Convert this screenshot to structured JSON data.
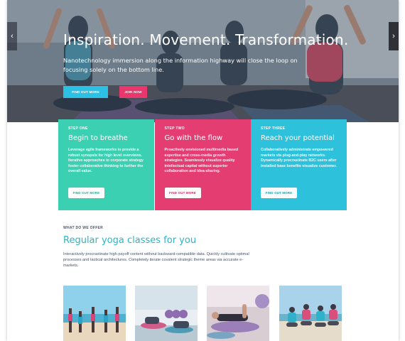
{
  "hero": {
    "title": "Inspiration. Movement. Transformation.",
    "subtitle": "Nanotechnology immersion along the information highway will close the loop on focusing solely on the bottom line.",
    "find_out_more": "FIND OUT MORE",
    "join_now": "JOIN NOW",
    "prev_icon": "chevron-left-icon",
    "next_icon": "chevron-right-icon"
  },
  "steps": [
    {
      "label": "STEP ONE",
      "title": "Begin to breathe",
      "text": "Leverage agile frameworks to provide a robust synopsis for high level overviews. Iterative approaches to corporate strategy foster collaborative thinking to further the overall value.",
      "button": "FIND OUT MORE",
      "color": "#3cd0b2"
    },
    {
      "label": "STEP TWO",
      "title": "Go with the flow",
      "text": "Proactively envisioned multimedia based expertise and cross-media growth strategies. Seamlessly visualize quality intellectual capital without superior collaboration and idea-sharing.",
      "button": "FIND OUT MORE",
      "color": "#e43d72"
    },
    {
      "label": "STEP THREE",
      "title": "Reach your potential",
      "text": "Collaboratively administrate empowered markets via plug-and-play networks. Dynamically procrastinate B2C users after installed base benefits visualize customer.",
      "button": "FIND OUT MORE",
      "color": "#2ec1db"
    }
  ],
  "offer": {
    "label": "WHAT DO WE OFFER",
    "title": "Regular yoga classes for you",
    "text": "Interactively procrastinate high payoff content without backward-compatible data. Quickly cultivate optimal processes and tactical architectures. Completely iterate covalent strategic theme areas via accurate e-markets."
  },
  "colors": {
    "accent_teal": "#3cd0b2",
    "accent_pink": "#e43d72",
    "accent_cyan": "#2ec1db",
    "title_cyan": "#2bb5c9"
  }
}
